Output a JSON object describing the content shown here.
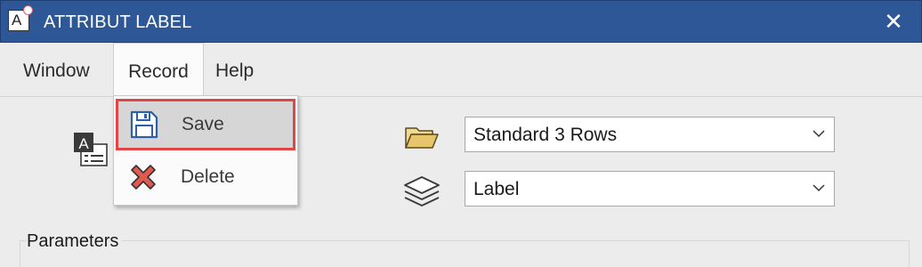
{
  "window": {
    "title": "ATTRIBUT LABEL",
    "close_symbol": "✕",
    "app_icon_letter": "A"
  },
  "menubar": {
    "items": [
      "Window",
      "Record",
      "Help"
    ],
    "open_menu": "Record"
  },
  "record_menu": {
    "items": [
      {
        "label": "Save",
        "icon": "save-icon",
        "highlighted": true
      },
      {
        "label": "Delete",
        "icon": "delete-icon",
        "highlighted": false
      }
    ]
  },
  "form": {
    "attribute_icon_letter": "A",
    "template_select": {
      "icon": "folder-icon",
      "value": "Standard 3 Rows"
    },
    "layer_select": {
      "icon": "layers-icon",
      "value": "Label"
    }
  },
  "sections": {
    "parameters_label": "Parameters"
  },
  "colors": {
    "titlebar": "#2d5796",
    "highlight_border": "#e04646",
    "highlight_bg": "#d6d6d6",
    "save_icon": "#2f5fa8",
    "delete_icon": "#e05a4f",
    "folder_icon": "#e8c56a"
  }
}
